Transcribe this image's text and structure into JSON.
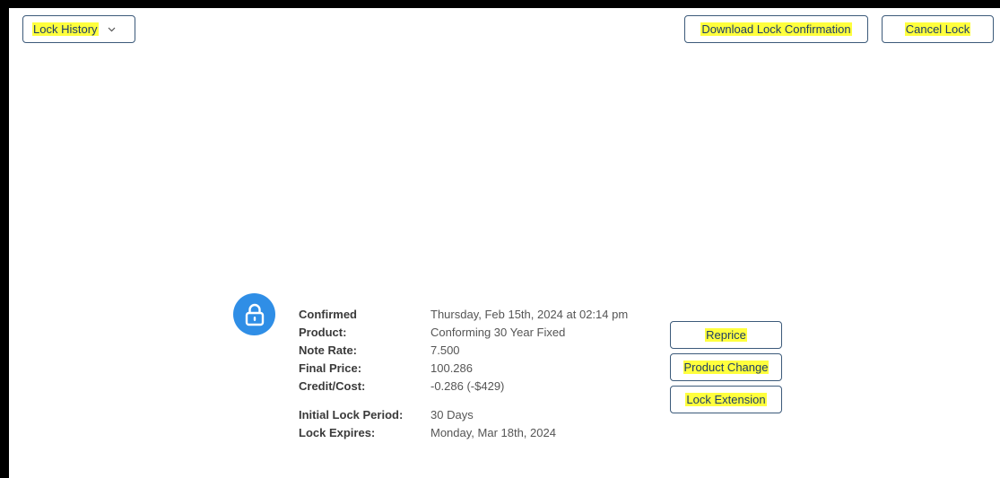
{
  "toolbar": {
    "lock_history_label": "Lock History",
    "download_label": "Download Lock Confirmation",
    "cancel_label": "Cancel Lock"
  },
  "lock_details": {
    "status_label": "Confirmed",
    "status_value": "Thursday, Feb 15th, 2024 at 02:14 pm",
    "product_label": "Product:",
    "product_value": "Conforming 30 Year Fixed",
    "note_rate_label": "Note Rate:",
    "note_rate_value": "7.500",
    "final_price_label": "Final Price:",
    "final_price_value": "100.286",
    "credit_cost_label": "Credit/Cost:",
    "credit_cost_value": "-0.286 (-$429)",
    "initial_period_label": "Initial Lock Period:",
    "initial_period_value": "30 Days",
    "expires_label": "Lock Expires:",
    "expires_value": "Monday, Mar 18th, 2024"
  },
  "actions": {
    "reprice_label": "Reprice",
    "product_change_label": "Product Change",
    "lock_extension_label": "Lock Extension"
  },
  "icons": {
    "lock": "lock-icon",
    "chevron": "chevron-down-icon"
  },
  "colors": {
    "accent_blue": "#2f8ee6",
    "highlight": "#ffff3d",
    "button_border": "#3c5a7a"
  }
}
